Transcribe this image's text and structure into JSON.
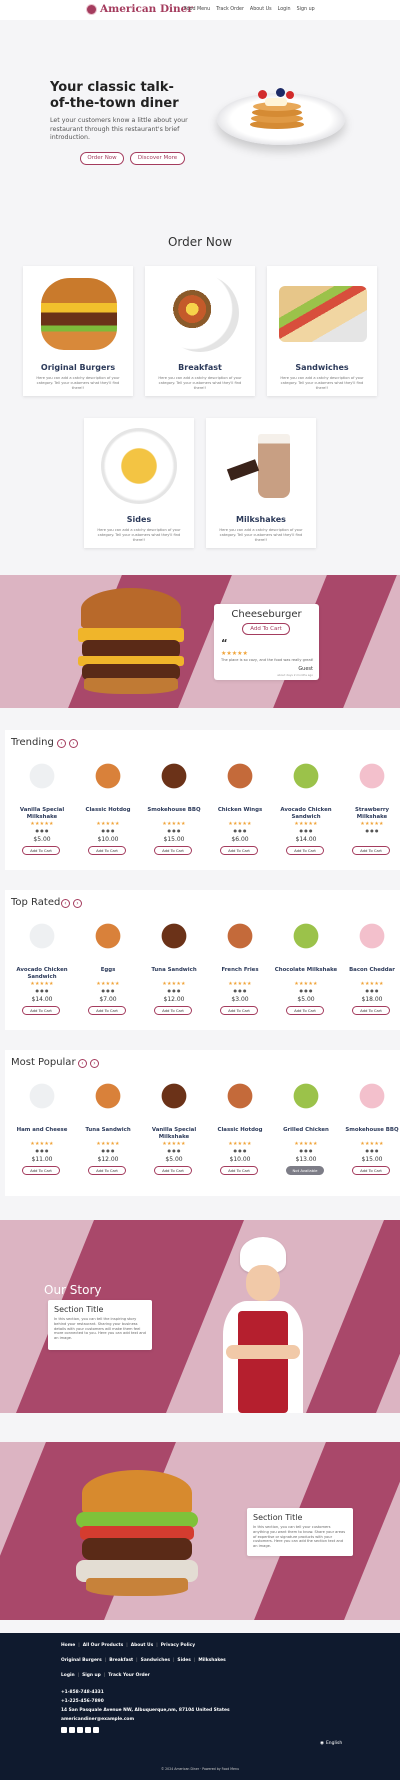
{
  "brand": {
    "name": "American Diner"
  },
  "nav": [
    "Food Menu",
    "Track Order",
    "About Us",
    "Login",
    "Sign up"
  ],
  "hero": {
    "title": "Your classic talk-of-the-town diner",
    "subtitle": "Let your customers know a little about your restaurant through this restaurant's brief introduction.",
    "btn_order": "Order Now",
    "btn_discover": "Discover More"
  },
  "order_now": {
    "title": "Order Now",
    "desc": "Here you can add a catchy description of your category. Tell your customers what they'll find there!!",
    "categories": [
      "Original Burgers",
      "Breakfast",
      "Sandwiches",
      "Sides",
      "Milkshakes"
    ]
  },
  "promo": {
    "name": "Cheeseburger",
    "btn": "Add To Cart",
    "quote_mark": "“",
    "stars": "★★★★★",
    "review": "The place is so cozy, and the food was really great!",
    "reviewer": "Guest",
    "date": "about days 2 months ago"
  },
  "trending": {
    "title": "Trending",
    "items": [
      {
        "name": "Vanilla Special Milkshake",
        "price": "$5.00",
        "btn": "Add To Cart"
      },
      {
        "name": "Classic Hotdog",
        "price": "$10.00",
        "btn": "Add To Cart"
      },
      {
        "name": "Smokehouse BBQ",
        "price": "$15.00",
        "btn": "Add To Cart"
      },
      {
        "name": "Chicken Wings",
        "price": "$6.00",
        "btn": "Add To Cart"
      },
      {
        "name": "Avocado Chicken Sandwich",
        "price": "$14.00",
        "btn": "Add To Cart"
      },
      {
        "name": "Strawberry Milkshake",
        "price": "",
        "btn": "Add To Cart"
      }
    ]
  },
  "toprated": {
    "title": "Top Rated",
    "items": [
      {
        "name": "Avocado Chicken Sandwich",
        "price": "$14.00",
        "btn": "Add To Cart"
      },
      {
        "name": "Eggs",
        "price": "$7.00",
        "btn": "Add To Cart"
      },
      {
        "name": "Tuna Sandwich",
        "price": "$12.00",
        "btn": "Add To Cart"
      },
      {
        "name": "French Fries",
        "price": "$3.00",
        "btn": "Add To Cart"
      },
      {
        "name": "Chocolate Milkshake",
        "price": "$5.00",
        "btn": "Add To Cart"
      },
      {
        "name": "Bacon Cheddar",
        "price": "$18.00",
        "btn": "Add To Cart"
      }
    ]
  },
  "popular": {
    "title": "Most Popular",
    "items": [
      {
        "name": "Ham and Cheese",
        "price": "$11.00",
        "btn": "Add To Cart"
      },
      {
        "name": "Tuna Sandwich",
        "price": "$12.00",
        "btn": "Add To Cart"
      },
      {
        "name": "Vanilla Special Milkshake",
        "price": "$5.00",
        "btn": "Add To Cart"
      },
      {
        "name": "Classic Hotdog",
        "price": "$10.00",
        "btn": "Add To Cart"
      },
      {
        "name": "Grilled Chicken",
        "price": "$13.00",
        "btn": "Not Available"
      },
      {
        "name": "Smokehouse BBQ",
        "price": "$15.00",
        "btn": "Add To Cart"
      }
    ]
  },
  "story": {
    "title": "Our Story",
    "section_title": "Section Title",
    "section_text": "In this section, you can tell the inspiring story behind your restaurant. Sharing your business details with your customers will make them feel more connected to you. Here you can add text and an image."
  },
  "section2": {
    "title": "Section Title",
    "text": "In this section, you can tell your customers anything you want them to know. Share your areas of expertise or signature products with your customers. Here you can add the section text and an image."
  },
  "footer": {
    "row1": [
      "Home",
      "All Our Products",
      "About Us",
      "Privacy Policy"
    ],
    "row2": [
      "Original Burgers",
      "Breakfast",
      "Sandwiches",
      "Sides",
      "Milkshakes"
    ],
    "row3": [
      "Login",
      "Sign up",
      "Track Your Order"
    ],
    "phone1": "+1-858-748-4331",
    "phone2": "+1-225-456-7890",
    "address": "14 San Pasquale Avenue NW, Albuquerque,nm, 87104 United States",
    "email": "americandiner@example.com",
    "lang": "English",
    "copyright": "© 2024 American Diner · Powered by Food Menu"
  },
  "colors": {
    "accent": "#a43c5e",
    "band_light": "#dcb4c2",
    "band_dark": "#a9486a",
    "footer": "#0f1a2e",
    "star": "#f0a43a"
  }
}
